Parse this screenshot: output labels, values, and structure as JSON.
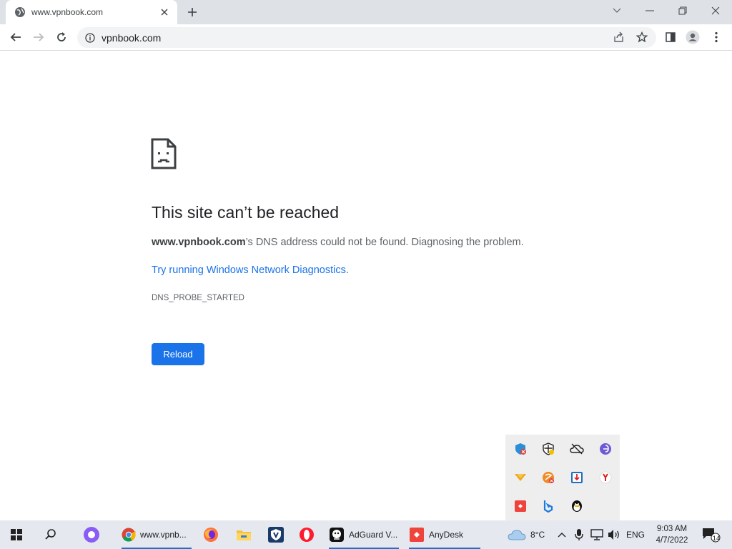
{
  "browser": {
    "tab": {
      "title": "www.vpnbook.com"
    },
    "omnibox": {
      "url": "vpnbook.com"
    }
  },
  "error_page": {
    "title": "This site can’t be reached",
    "host": "www.vpnbook.com",
    "message_rest": "’s DNS address could not be found. Diagnosing the problem.",
    "link_text": "Try running Windows Network Diagnostics",
    "link_suffix": ".",
    "error_code": "DNS_PROBE_STARTED",
    "reload_label": "Reload"
  },
  "taskbar": {
    "chrome_label": "www.vpnb...",
    "adguard_label": "AdGuard V...",
    "anydesk_label": "AnyDesk",
    "weather_temp": "8°C",
    "language": "ENG",
    "time": "9:03 AM",
    "date": "4/7/2022",
    "notification_count": "14"
  },
  "colors": {
    "accent": "#1a73e8",
    "tabstrip": "#dee1e6",
    "taskbar": "#e5e9ef"
  }
}
